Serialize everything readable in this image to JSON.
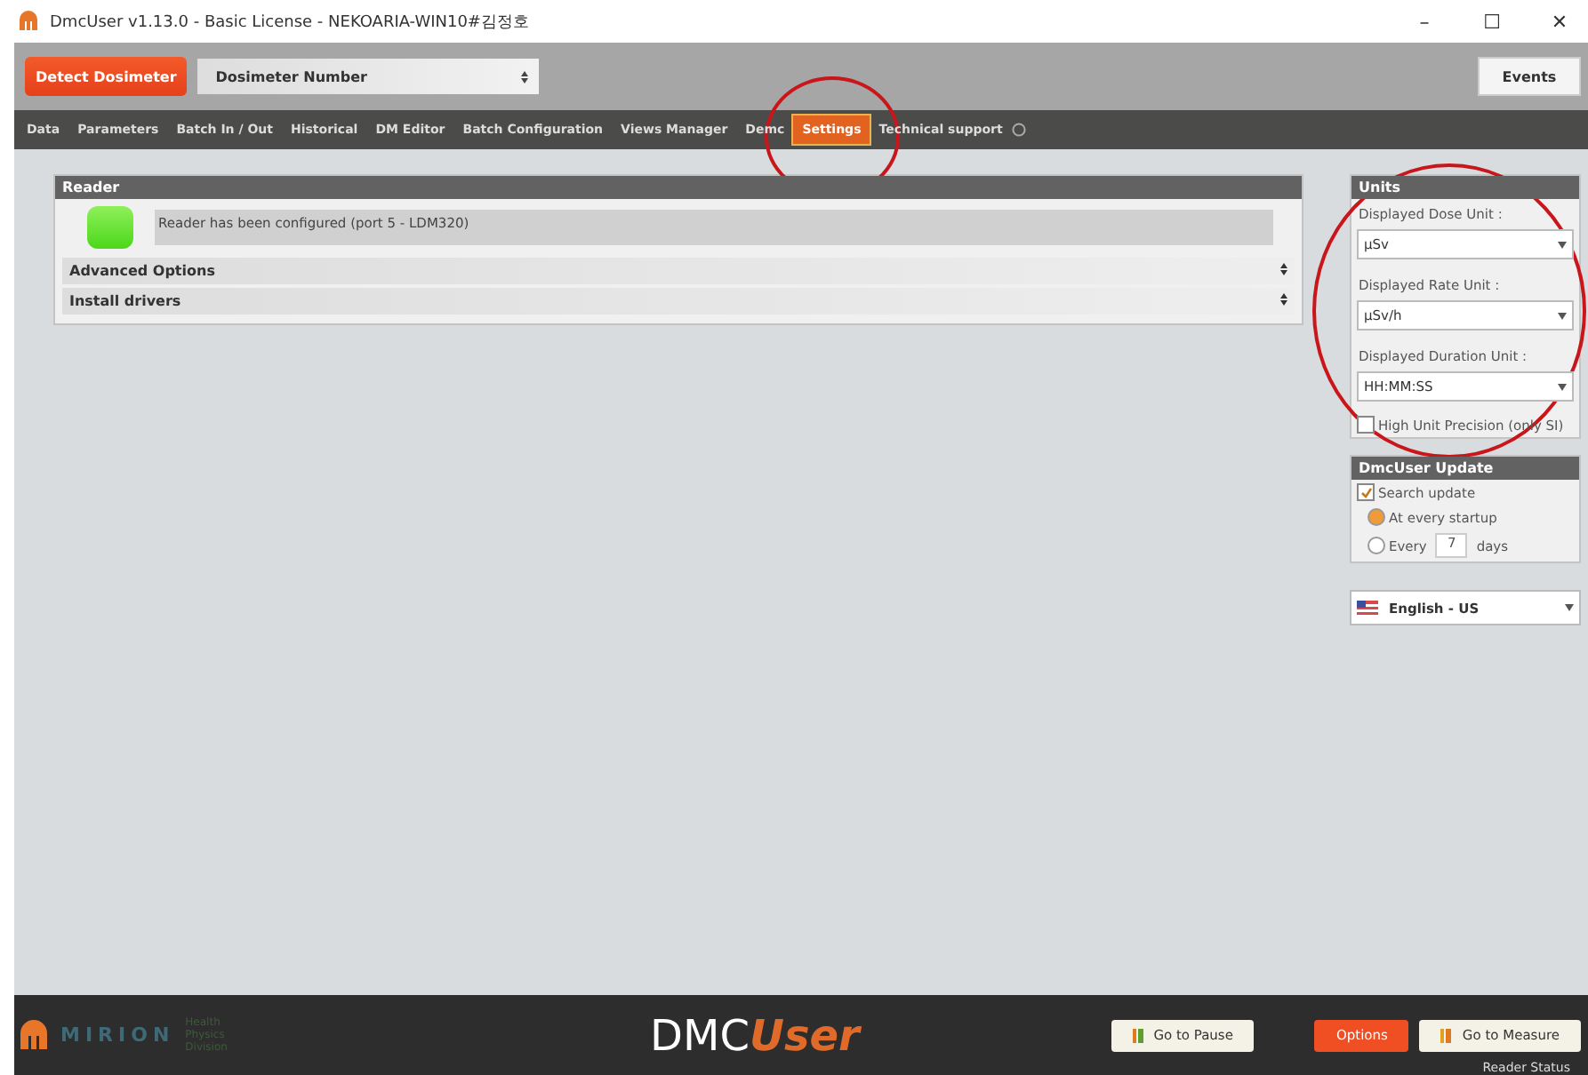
{
  "window": {
    "title": "DmcUser v1.13.0 - Basic License - NEKOARIA-WIN10#김정호",
    "controls": [
      "–",
      "☐",
      "✕"
    ]
  },
  "toolbar": {
    "detect_button": "Detect Dosimeter",
    "dosimeter_select": "Dosimeter Number",
    "events_button": "Events"
  },
  "tabs": [
    {
      "label": "Data",
      "selected": false
    },
    {
      "label": "Parameters",
      "selected": false
    },
    {
      "label": "Batch In / Out",
      "selected": false
    },
    {
      "label": "Historical",
      "selected": false
    },
    {
      "label": "DM Editor",
      "selected": false
    },
    {
      "label": "Batch Configuration",
      "selected": false
    },
    {
      "label": "Views Manager",
      "selected": false
    },
    {
      "label": "Demc",
      "selected": false
    },
    {
      "label": "Settings",
      "selected": true
    },
    {
      "label": "Technical support",
      "selected": false
    }
  ],
  "reader": {
    "title": "Reader",
    "status": "Reader has been configured (port 5 - LDM320)",
    "sections": [
      {
        "label": "Advanced Options",
        "expanded": false
      },
      {
        "label": "Install drivers",
        "expanded": false
      }
    ]
  },
  "units": {
    "title": "Units",
    "fields": [
      {
        "label": "Displayed Dose Unit :",
        "value": "µSv"
      },
      {
        "label": "Displayed Rate Unit :",
        "value": "µSv/h"
      },
      {
        "label": "Displayed Duration Unit :",
        "value": "HH:MM:SS"
      }
    ],
    "precision": {
      "label": "High Unit Precision (only SI)",
      "checked": false
    }
  },
  "update": {
    "title": "DmcUser Update",
    "search": {
      "label": "Search update",
      "checked": true
    },
    "options": [
      {
        "label": "At every startup",
        "selected": true
      },
      {
        "label": "Every",
        "selected": false,
        "value": "7",
        "suffix": "days"
      }
    ]
  },
  "language": {
    "value": "English - US"
  },
  "footer": {
    "brand": "MIRION",
    "brand_sub": "Health Physics Division",
    "logo_main": "DMC",
    "logo_accent": "User",
    "pause_button": "Go to Pause",
    "options_button": "Options",
    "measure_button": "Go to Measure",
    "reader_status": "Reader Status"
  }
}
